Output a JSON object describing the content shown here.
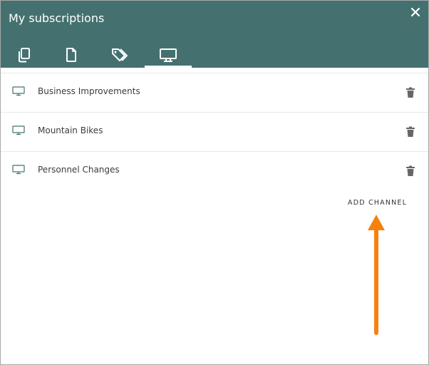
{
  "dialog": {
    "title": "My subscriptions",
    "header_color": "#447170",
    "close_icon": "close-icon"
  },
  "tabs": [
    {
      "icon": "copy-icon",
      "active": false
    },
    {
      "icon": "document-icon",
      "active": false
    },
    {
      "icon": "tags-icon",
      "active": false
    },
    {
      "icon": "monitor-icon",
      "active": true
    }
  ],
  "subscriptions": [
    {
      "name": "Business Improvements",
      "icon": "monitor-icon",
      "action_icon": "trash-icon"
    },
    {
      "name": "Mountain Bikes",
      "icon": "monitor-icon",
      "action_icon": "trash-icon"
    },
    {
      "name": "Personnel Changes",
      "icon": "monitor-icon",
      "action_icon": "trash-icon"
    }
  ],
  "actions": {
    "add_channel_label": "ADD CHANNEL"
  },
  "annotation": {
    "arrow_color": "#f5820f"
  }
}
